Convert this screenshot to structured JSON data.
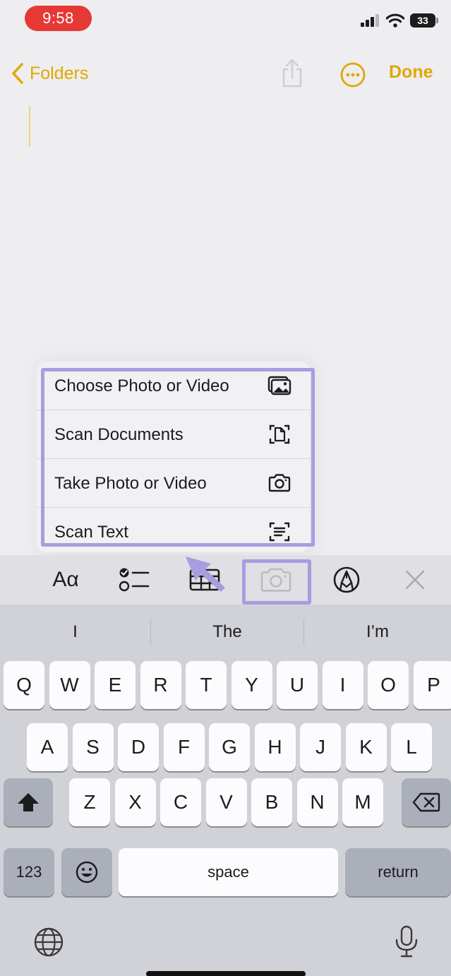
{
  "status_bar": {
    "time": "9:58",
    "battery": "33"
  },
  "nav": {
    "back_label": "Folders",
    "done_label": "Done"
  },
  "menu": {
    "items": [
      {
        "label": "Choose Photo or Video",
        "icon": "photo-library-icon"
      },
      {
        "label": "Scan Documents",
        "icon": "scan-document-icon"
      },
      {
        "label": "Take Photo or Video",
        "icon": "camera-icon"
      },
      {
        "label": "Scan Text",
        "icon": "scan-text-icon"
      }
    ]
  },
  "toolbar": {
    "format_label": "Aα",
    "buttons": [
      "text-format",
      "checklist-icon",
      "table-icon",
      "camera-icon",
      "markup-pen-icon",
      "close-icon"
    ]
  },
  "keyboard": {
    "suggestions": [
      "I",
      "The",
      "I’m"
    ],
    "row1": [
      "Q",
      "W",
      "E",
      "R",
      "T",
      "Y",
      "U",
      "I",
      "O",
      "P"
    ],
    "row2": [
      "A",
      "S",
      "D",
      "F",
      "G",
      "H",
      "J",
      "K",
      "L"
    ],
    "row3": [
      "Z",
      "X",
      "C",
      "V",
      "B",
      "N",
      "M"
    ],
    "numbers_label": "123",
    "space_label": "space",
    "return_label": "return"
  },
  "colors": {
    "accent": "#e0a800",
    "highlight": "#a99ce0",
    "time_pill": "#e53935"
  }
}
